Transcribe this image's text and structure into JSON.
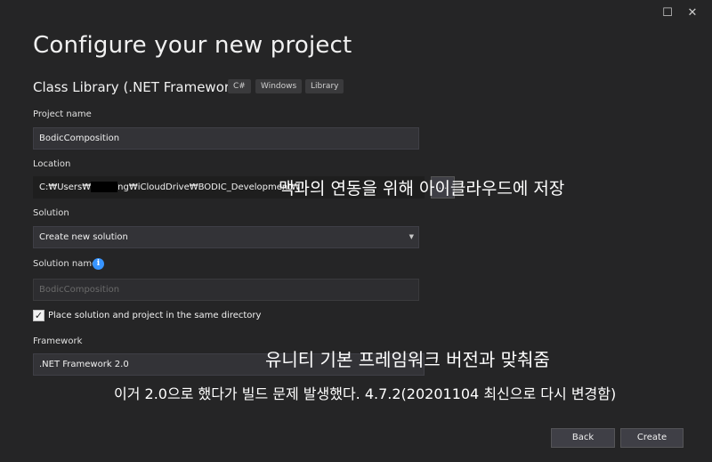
{
  "window": {
    "maximize_glyph": "☐",
    "close_glyph": "✕"
  },
  "page": {
    "title": "Configure your new project",
    "template_name": "Class Library (.NET Framework)",
    "tags": [
      "C#",
      "Windows",
      "Library"
    ]
  },
  "form": {
    "project_name_label": "Project name",
    "project_name_value": "BodicComposition",
    "location_label": "Location",
    "location_prefix": "C:₩Users₩",
    "location_suffix": "ng₩iCloudDrive₩BODIC_Development₩",
    "browse_label": "...",
    "solution_label": "Solution",
    "solution_value": "Create new solution",
    "solution_name_label": "Solution name",
    "solution_name_placeholder": "BodicComposition",
    "same_dir_label": "Place solution and project in the same directory",
    "same_dir_checked": true,
    "framework_label": "Framework",
    "framework_value": ".NET Framework 2.0"
  },
  "annotations": {
    "location_note": "맥과의 연동을 위해 아이클라우드에 저장",
    "framework_note": "유니티 기본 프레임워크 버전과 맞춰줌",
    "framework_note2": "이거 2.0으로 했다가 빌드 문제 발생했다. 4.7.2(20201104 최신으로 다시 변경함)"
  },
  "footer": {
    "back_label": "Back",
    "create_label": "Create"
  },
  "colors": {
    "background": "#252526",
    "field_bg": "#333337",
    "accent_info": "#3794ff"
  }
}
